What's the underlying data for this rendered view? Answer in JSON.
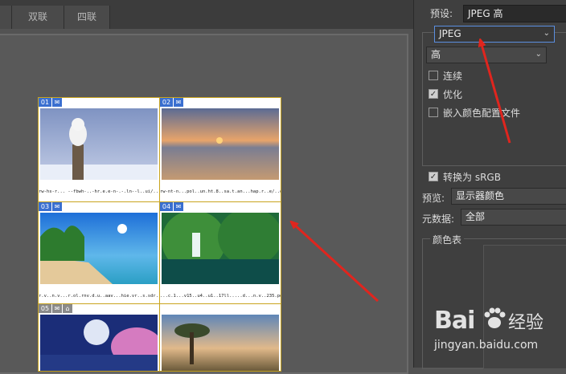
{
  "tabs": [
    {
      "label": ""
    },
    {
      "label": "双联"
    },
    {
      "label": "四联"
    }
  ],
  "preview": {
    "cells": [
      {
        "number": "01",
        "caption": "rw-hs-r... --fbwh-..-hr.e.e-n-.-.ln--l..ui/..,1u-.l...pg..",
        "scene": "owl"
      },
      {
        "number": "02",
        "caption": "rw-nt-n...pol..un.ht.8..sa.t.an...hap.r..e/..onen..l..h.gr...jpg",
        "scene": "sunset"
      },
      {
        "number": "03",
        "caption": "r.v..n.v...r.ol.rnv.d.u..aav...hie.vr..s.sdr...l.........pg.",
        "scene": "beach"
      },
      {
        "number": "04",
        "caption": "...c.1...v15..u4..u1..17ll.....d...n.v..235.pe...4l..jpg",
        "scene": "waterfall"
      },
      {
        "number": "05",
        "caption": "",
        "scene": "moon"
      },
      {
        "number": "",
        "caption": "",
        "scene": "tree"
      }
    ]
  },
  "settings": {
    "preset_label": "预设:",
    "preset_value": "JPEG 高",
    "format_value": "JPEG",
    "quality_value": "高",
    "progressive_label": "连续",
    "progressive_checked": false,
    "optimized_label": "优化",
    "optimized_checked": true,
    "embed_profile_label": "嵌入颜色配置文件",
    "embed_profile_checked": false,
    "convert_srgb_label": "转换为 sRGB",
    "convert_srgb_checked": true,
    "preview_label": "预览:",
    "preview_value": "显示器颜色",
    "metadata_label": "元数据:",
    "metadata_value": "全部",
    "color_table_label": "颜色表"
  },
  "watermark": {
    "logo_text": "Bai",
    "logo_text2": "经验",
    "url": "jingyan.baidu.com"
  },
  "colors": {
    "accent_blue": "#3a6fd0",
    "arrow_red": "#e0251e",
    "page_border": "#c9a41e"
  }
}
